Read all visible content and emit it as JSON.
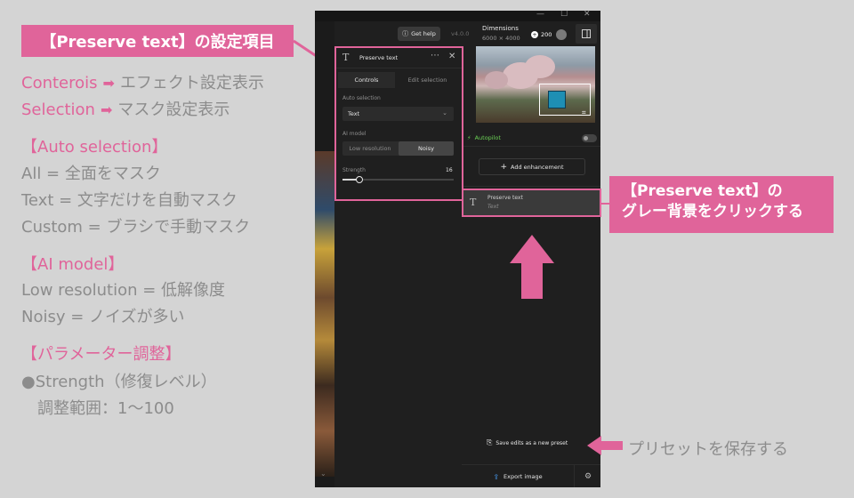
{
  "colors": {
    "accent": "#e0649a",
    "note_grey": "#8c8c8c",
    "app_bg": "#1f1f1f",
    "autopilot_green": "#6bd155"
  },
  "annotations": {
    "title": "【Preserve text】の設定項目",
    "controls_line": {
      "key": "Conterois",
      "value": "エフェクト設定表示"
    },
    "selection_line": {
      "key": "Selection",
      "value": "マスク設定表示"
    },
    "auto_selection": {
      "heading": "【Auto selection】",
      "items": [
        "All = 全面をマスク",
        "Text = 文字だけを自動マスク",
        "Custom = ブラシで手動マスク"
      ]
    },
    "ai_model": {
      "heading": "【AI model】",
      "items": [
        "Low resolution = 低解像度",
        "Noisy = ノイズが多い"
      ]
    },
    "params": {
      "heading": "【パラメーター調整】",
      "strength": "●Strength（修復レベル）",
      "range": "調整範囲：1〜100"
    },
    "callout_line1": "【Preserve text】の",
    "callout_line2": "グレー背景をクリックする",
    "preset_note": "プリセットを保存する"
  },
  "app": {
    "header": {
      "get_help": "Get help",
      "version": "v4.0.0",
      "dimensions_label": "Dimensions",
      "dimensions_value": "6000 × 4000",
      "credits": "200"
    },
    "panel": {
      "title": "Preserve text",
      "tabs": [
        "Controls",
        "Edit selection"
      ],
      "auto_selection_label": "Auto selection",
      "auto_selection_value": "Text",
      "ai_model_label": "AI model",
      "ai_model_options": [
        "Low resolution",
        "Noisy"
      ],
      "ai_model_selected": "Noisy",
      "strength_label": "Strength",
      "strength_value": 16,
      "strength_min": 1,
      "strength_max": 100
    },
    "sidebar": {
      "autopilot_label": "Autopilot",
      "autopilot_on": false,
      "add_enhancement": "Add enhancement",
      "layer_name": "Preserve text",
      "layer_sub": "Text",
      "save_preset": "Save edits as a new preset",
      "export": "Export image"
    }
  }
}
